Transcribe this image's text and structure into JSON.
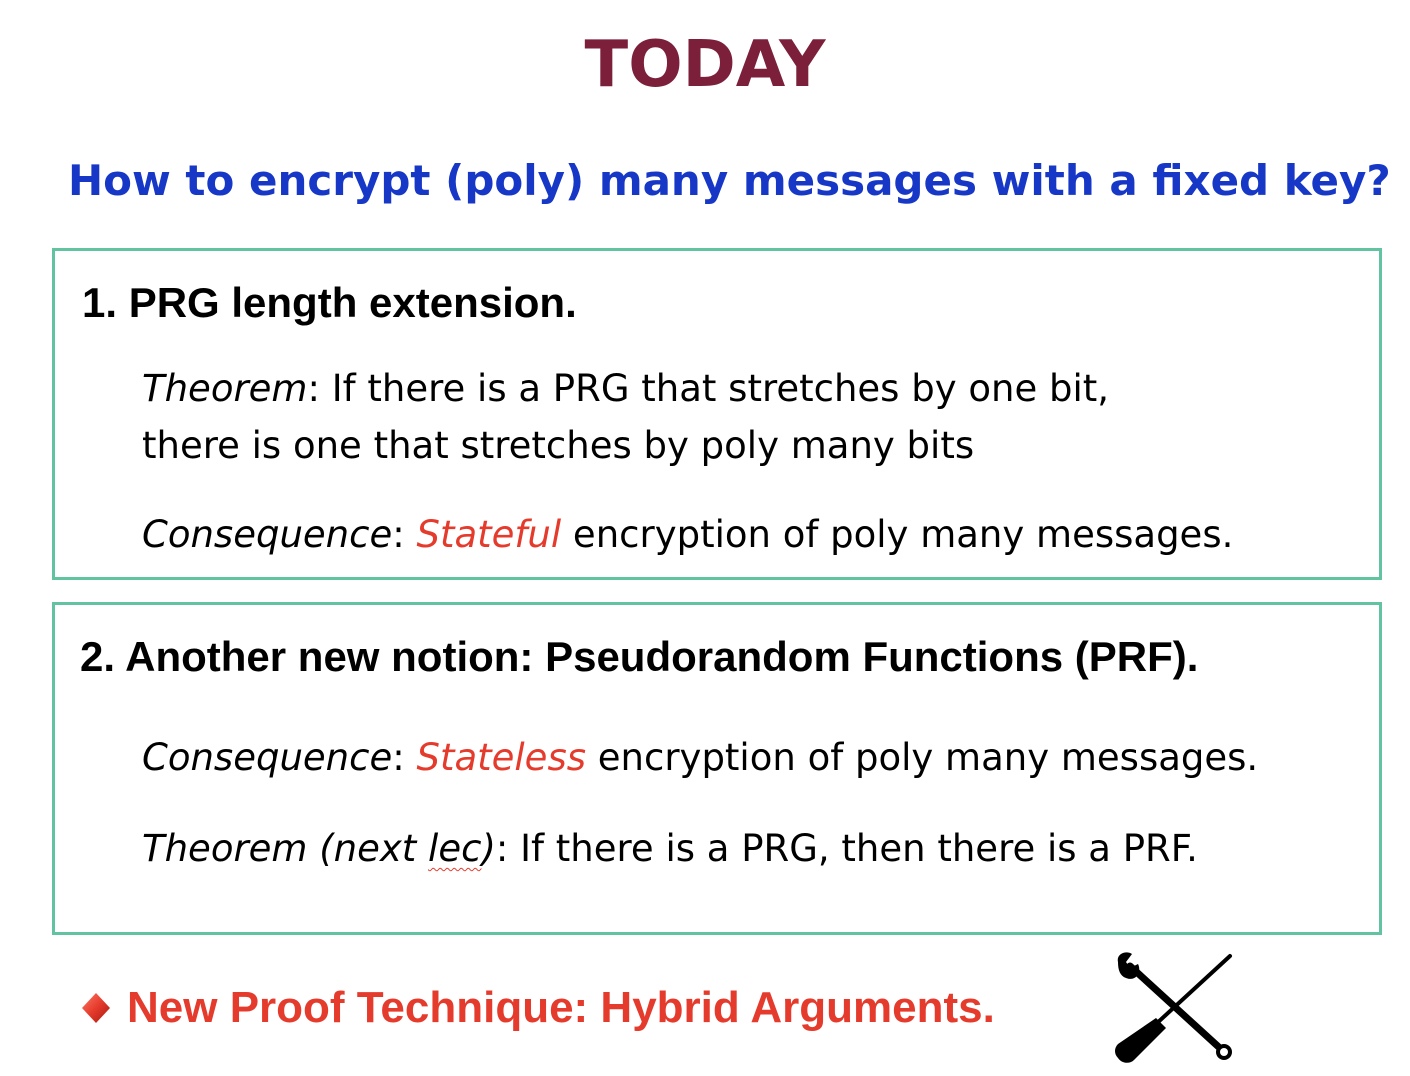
{
  "title": "TODAY",
  "question": "How to encrypt (poly) many messages with a fixed key?",
  "section1": {
    "heading": "1. PRG length extension.",
    "theorem_label": "Theorem",
    "theorem_text_1": ": If there is a PRG  that stretches by one bit,",
    "theorem_text_2": "there is one that stretches by poly many bits",
    "consequence_label": "Consequence",
    "consequence_colon": ": ",
    "consequence_highlight": "Stateful",
    "consequence_rest": " encryption of poly many messages."
  },
  "section2": {
    "heading": "2. Another new notion: Pseudorandom Functions (PRF).",
    "consequence_label": "Consequence",
    "consequence_colon": ": ",
    "consequence_highlight": "Stateless",
    "consequence_rest": " encryption of poly many messages.",
    "theorem_label_a": "Theorem (next ",
    "theorem_label_b": "lec",
    "theorem_label_c": ")",
    "theorem_text": ": If there is a PRG, then there is a PRF."
  },
  "footer": {
    "bullet_icon": "red-diamond-bullet-icon",
    "technique": "New Proof Technique: Hybrid Arguments.",
    "tools_icon": "wrench-screwdriver-icon"
  },
  "colors": {
    "title": "#7b1f3a",
    "question": "#1737c6",
    "box_border": "#62c3a0",
    "accent_red": "#e53b2c"
  }
}
